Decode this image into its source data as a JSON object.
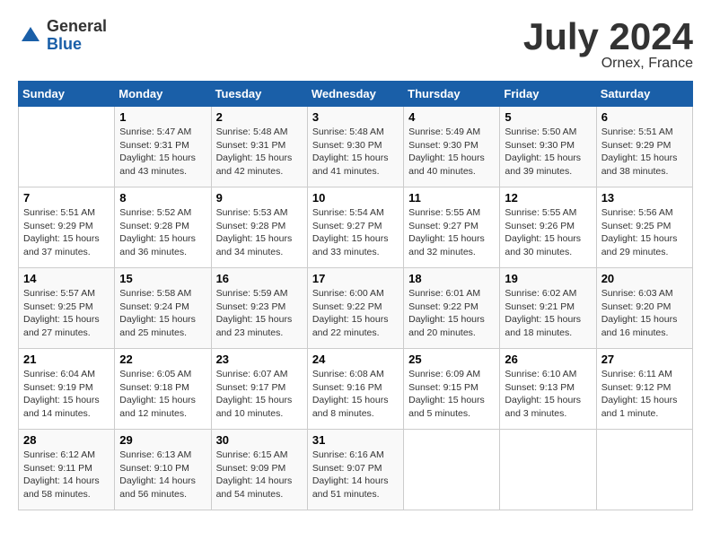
{
  "logo": {
    "general": "General",
    "blue": "Blue"
  },
  "title": "July 2024",
  "subtitle": "Ornex, France",
  "days_header": [
    "Sunday",
    "Monday",
    "Tuesday",
    "Wednesday",
    "Thursday",
    "Friday",
    "Saturday"
  ],
  "weeks": [
    [
      {
        "day": "",
        "info": ""
      },
      {
        "day": "1",
        "info": "Sunrise: 5:47 AM\nSunset: 9:31 PM\nDaylight: 15 hours\nand 43 minutes."
      },
      {
        "day": "2",
        "info": "Sunrise: 5:48 AM\nSunset: 9:31 PM\nDaylight: 15 hours\nand 42 minutes."
      },
      {
        "day": "3",
        "info": "Sunrise: 5:48 AM\nSunset: 9:30 PM\nDaylight: 15 hours\nand 41 minutes."
      },
      {
        "day": "4",
        "info": "Sunrise: 5:49 AM\nSunset: 9:30 PM\nDaylight: 15 hours\nand 40 minutes."
      },
      {
        "day": "5",
        "info": "Sunrise: 5:50 AM\nSunset: 9:30 PM\nDaylight: 15 hours\nand 39 minutes."
      },
      {
        "day": "6",
        "info": "Sunrise: 5:51 AM\nSunset: 9:29 PM\nDaylight: 15 hours\nand 38 minutes."
      }
    ],
    [
      {
        "day": "7",
        "info": "Sunrise: 5:51 AM\nSunset: 9:29 PM\nDaylight: 15 hours\nand 37 minutes."
      },
      {
        "day": "8",
        "info": "Sunrise: 5:52 AM\nSunset: 9:28 PM\nDaylight: 15 hours\nand 36 minutes."
      },
      {
        "day": "9",
        "info": "Sunrise: 5:53 AM\nSunset: 9:28 PM\nDaylight: 15 hours\nand 34 minutes."
      },
      {
        "day": "10",
        "info": "Sunrise: 5:54 AM\nSunset: 9:27 PM\nDaylight: 15 hours\nand 33 minutes."
      },
      {
        "day": "11",
        "info": "Sunrise: 5:55 AM\nSunset: 9:27 PM\nDaylight: 15 hours\nand 32 minutes."
      },
      {
        "day": "12",
        "info": "Sunrise: 5:55 AM\nSunset: 9:26 PM\nDaylight: 15 hours\nand 30 minutes."
      },
      {
        "day": "13",
        "info": "Sunrise: 5:56 AM\nSunset: 9:25 PM\nDaylight: 15 hours\nand 29 minutes."
      }
    ],
    [
      {
        "day": "14",
        "info": "Sunrise: 5:57 AM\nSunset: 9:25 PM\nDaylight: 15 hours\nand 27 minutes."
      },
      {
        "day": "15",
        "info": "Sunrise: 5:58 AM\nSunset: 9:24 PM\nDaylight: 15 hours\nand 25 minutes."
      },
      {
        "day": "16",
        "info": "Sunrise: 5:59 AM\nSunset: 9:23 PM\nDaylight: 15 hours\nand 23 minutes."
      },
      {
        "day": "17",
        "info": "Sunrise: 6:00 AM\nSunset: 9:22 PM\nDaylight: 15 hours\nand 22 minutes."
      },
      {
        "day": "18",
        "info": "Sunrise: 6:01 AM\nSunset: 9:22 PM\nDaylight: 15 hours\nand 20 minutes."
      },
      {
        "day": "19",
        "info": "Sunrise: 6:02 AM\nSunset: 9:21 PM\nDaylight: 15 hours\nand 18 minutes."
      },
      {
        "day": "20",
        "info": "Sunrise: 6:03 AM\nSunset: 9:20 PM\nDaylight: 15 hours\nand 16 minutes."
      }
    ],
    [
      {
        "day": "21",
        "info": "Sunrise: 6:04 AM\nSunset: 9:19 PM\nDaylight: 15 hours\nand 14 minutes."
      },
      {
        "day": "22",
        "info": "Sunrise: 6:05 AM\nSunset: 9:18 PM\nDaylight: 15 hours\nand 12 minutes."
      },
      {
        "day": "23",
        "info": "Sunrise: 6:07 AM\nSunset: 9:17 PM\nDaylight: 15 hours\nand 10 minutes."
      },
      {
        "day": "24",
        "info": "Sunrise: 6:08 AM\nSunset: 9:16 PM\nDaylight: 15 hours\nand 8 minutes."
      },
      {
        "day": "25",
        "info": "Sunrise: 6:09 AM\nSunset: 9:15 PM\nDaylight: 15 hours\nand 5 minutes."
      },
      {
        "day": "26",
        "info": "Sunrise: 6:10 AM\nSunset: 9:13 PM\nDaylight: 15 hours\nand 3 minutes."
      },
      {
        "day": "27",
        "info": "Sunrise: 6:11 AM\nSunset: 9:12 PM\nDaylight: 15 hours\nand 1 minute."
      }
    ],
    [
      {
        "day": "28",
        "info": "Sunrise: 6:12 AM\nSunset: 9:11 PM\nDaylight: 14 hours\nand 58 minutes."
      },
      {
        "day": "29",
        "info": "Sunrise: 6:13 AM\nSunset: 9:10 PM\nDaylight: 14 hours\nand 56 minutes."
      },
      {
        "day": "30",
        "info": "Sunrise: 6:15 AM\nSunset: 9:09 PM\nDaylight: 14 hours\nand 54 minutes."
      },
      {
        "day": "31",
        "info": "Sunrise: 6:16 AM\nSunset: 9:07 PM\nDaylight: 14 hours\nand 51 minutes."
      },
      {
        "day": "",
        "info": ""
      },
      {
        "day": "",
        "info": ""
      },
      {
        "day": "",
        "info": ""
      }
    ]
  ]
}
